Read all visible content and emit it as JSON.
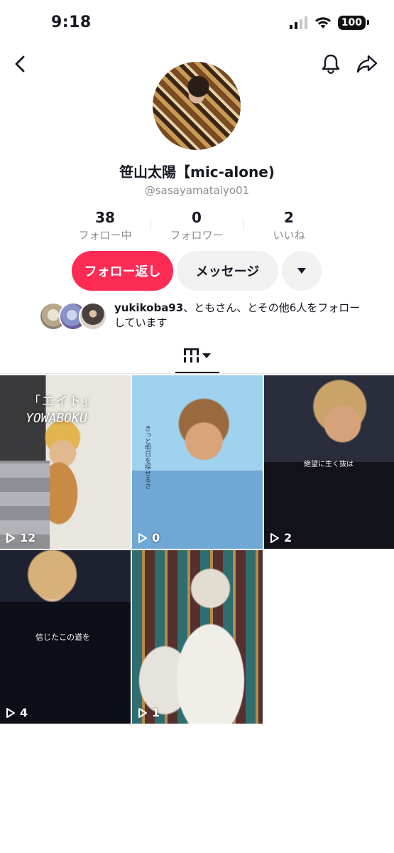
{
  "status_bar": {
    "time": "9:18",
    "battery": "100"
  },
  "profile": {
    "display_name": "笹山太陽【mic-alone)",
    "username": "@sasayamataiyo01",
    "stats": [
      {
        "value": "38",
        "label": "フォロー中"
      },
      {
        "value": "0",
        "label": "フォロワー"
      },
      {
        "value": "2",
        "label": "いいね"
      }
    ]
  },
  "actions": {
    "follow_back": "フォロー返し",
    "message": "メッセージ"
  },
  "mutual": {
    "name": "yukikoba93",
    "rest": "、ともさん、とその他6人をフォローしています"
  },
  "videos": [
    {
      "views": "12",
      "caption_1": "「エイト」",
      "caption_2": "YOWABOKU"
    },
    {
      "views": "0",
      "caption_1": "きっと明日を探せるさ"
    },
    {
      "views": "2",
      "caption_1": "絶望に生く抜は"
    },
    {
      "views": "4",
      "caption_1": "信じたこの道を"
    },
    {
      "views": "1"
    }
  ],
  "icons": [
    "back-icon",
    "bell-icon",
    "share-icon",
    "caret-down-icon",
    "grid-icon",
    "play-icon"
  ],
  "colors": {
    "accent": "#fe2c55",
    "secondary_button": "#f1f1f2"
  }
}
